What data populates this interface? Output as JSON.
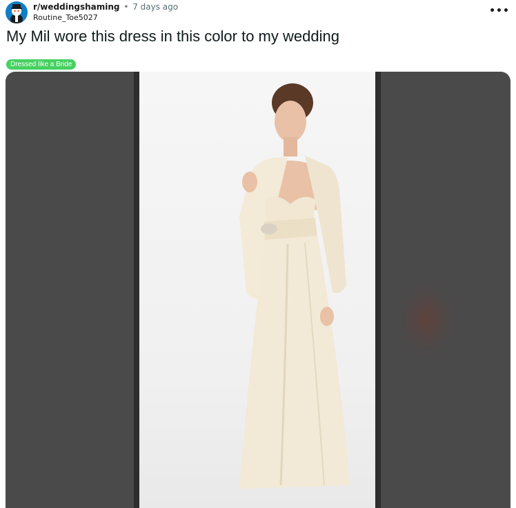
{
  "post": {
    "subreddit": "r/weddingshaming",
    "separator": "•",
    "age": "7 days ago",
    "author": "Routine_Toe5027",
    "more_label": "•••",
    "title": "My Mil wore this dress in this color to my wedding",
    "flair": "Dressed like a Bride"
  },
  "colors": {
    "flair_bg": "#46d160",
    "avatar_bg": "#0e7fc6",
    "media_bg": "#4a4a4a"
  },
  "icons": {
    "avatar": "subreddit-avatar-icon",
    "more": "more-options-icon"
  },
  "media": {
    "description_visible": false
  }
}
